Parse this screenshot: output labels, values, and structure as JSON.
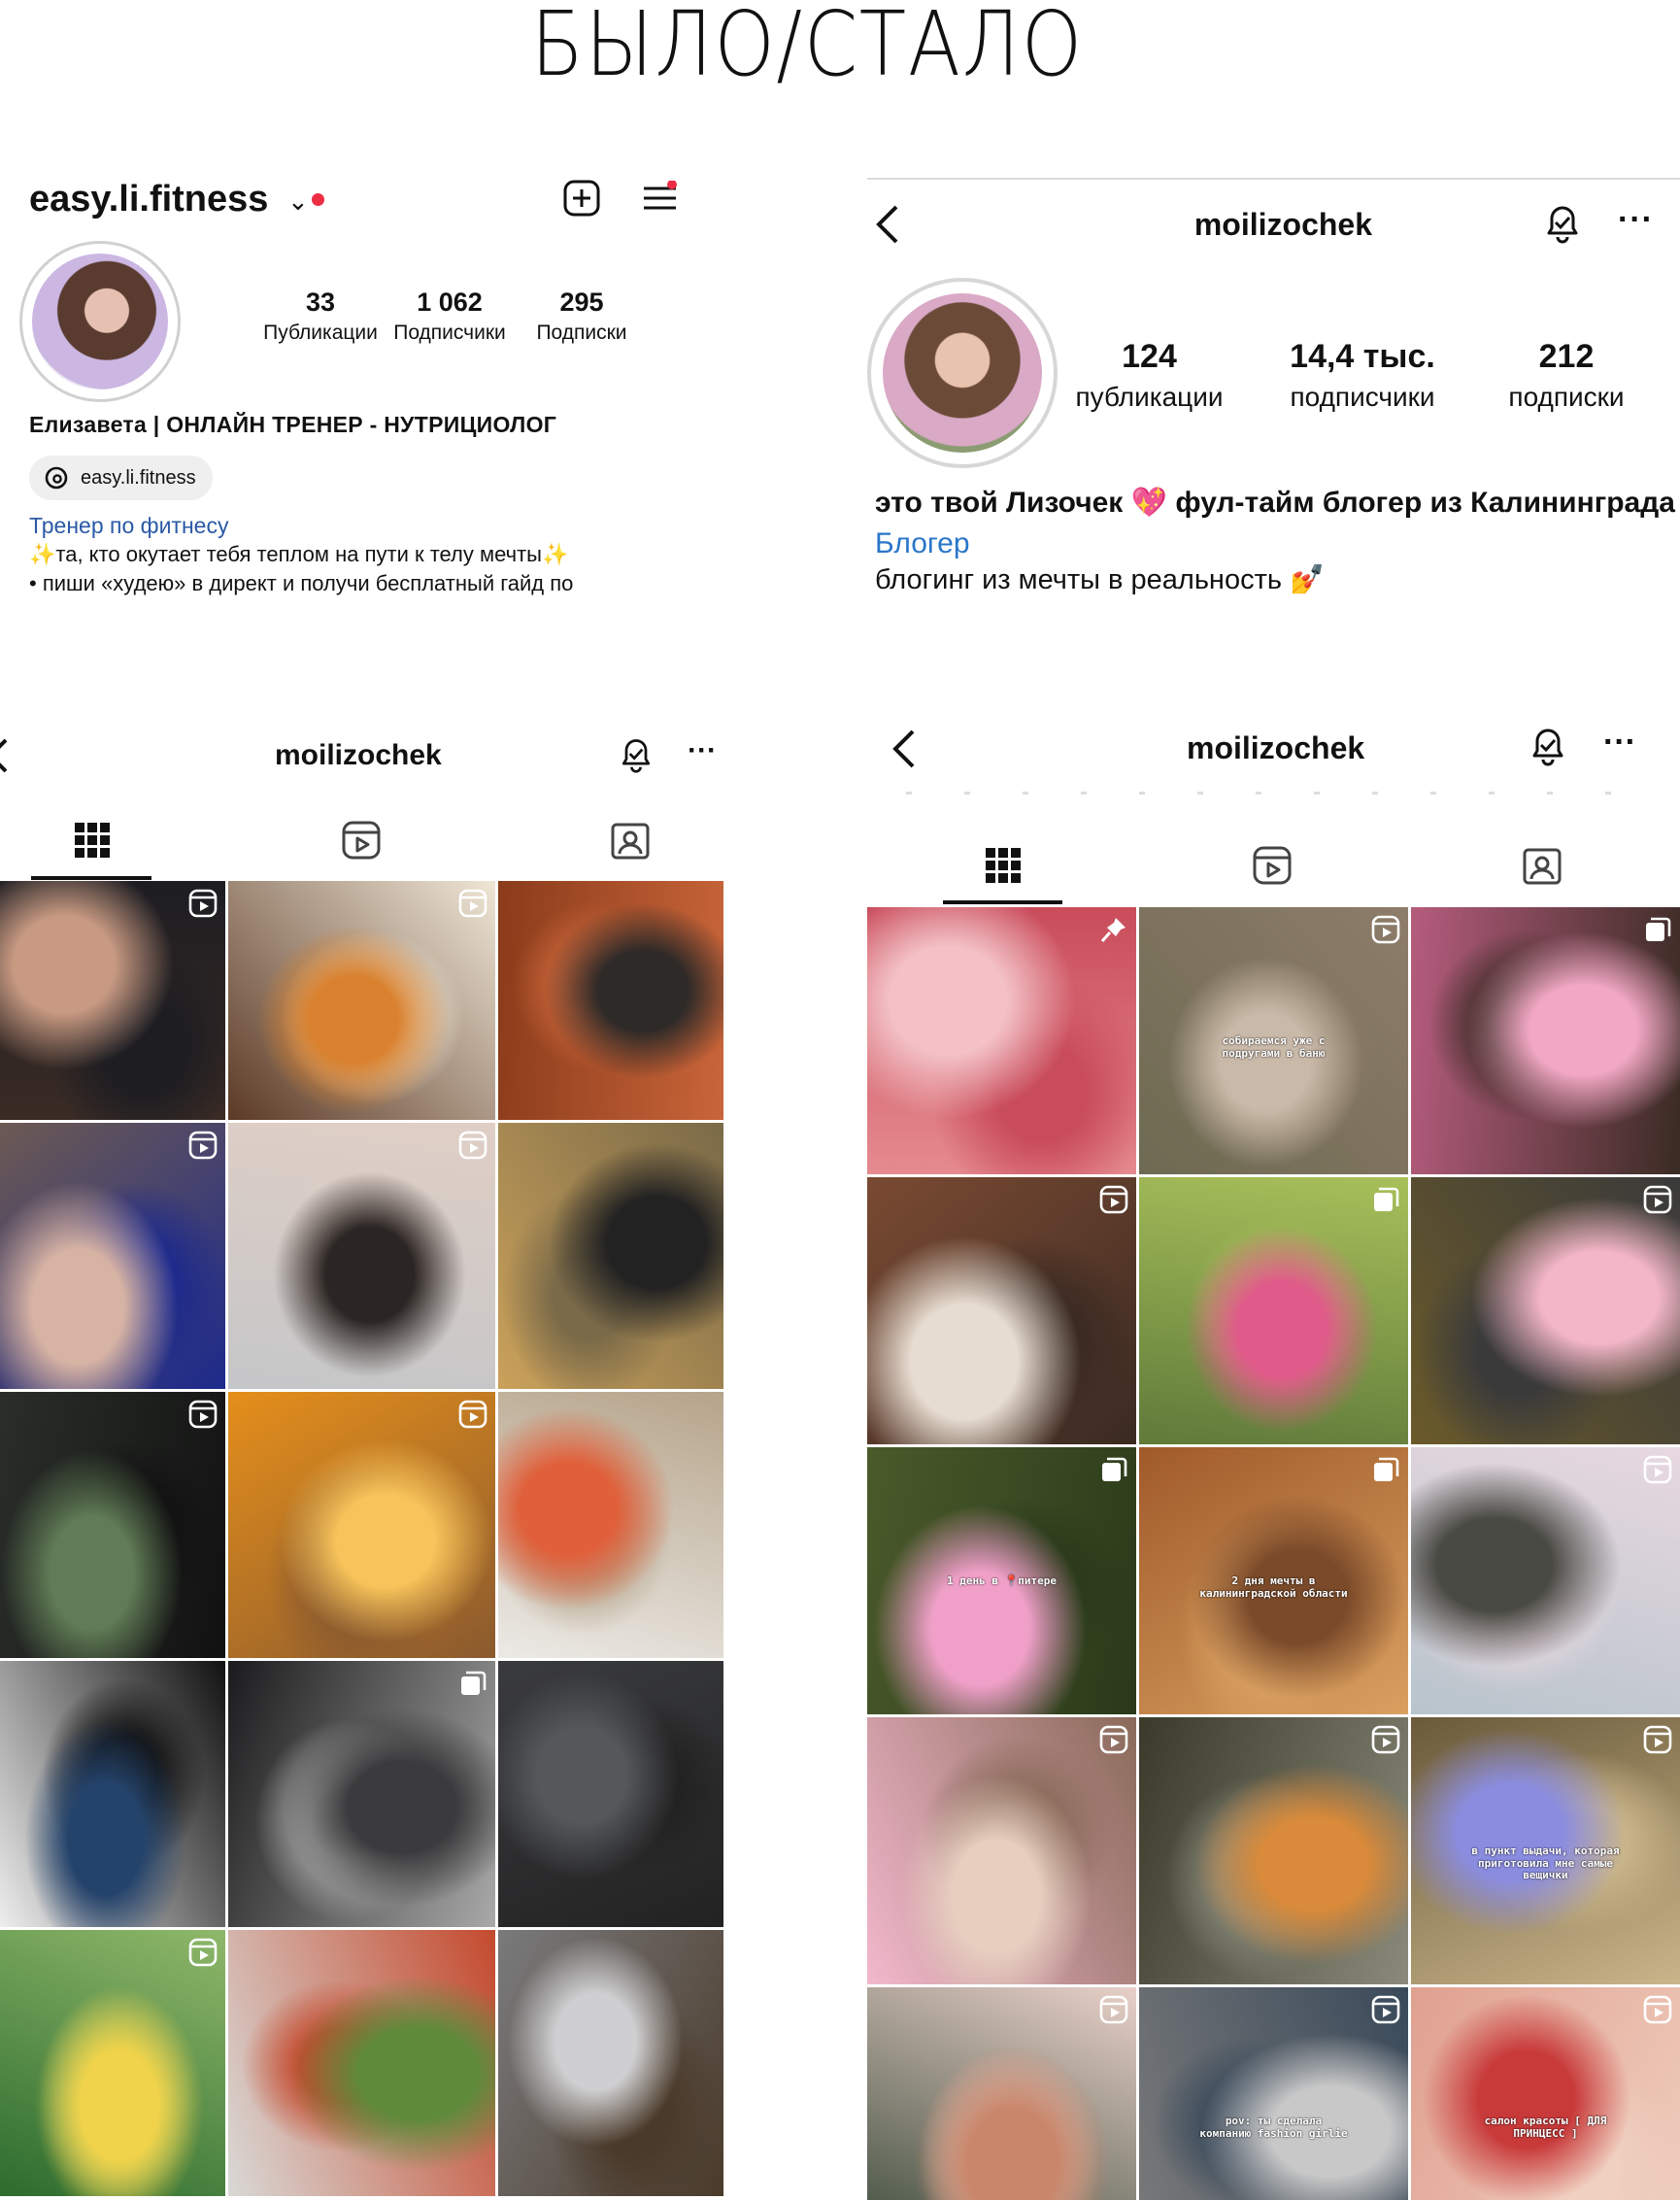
{
  "page_title": "БЫЛО/СТАЛО",
  "before_profile": {
    "username": "easy.li.fitness",
    "stats": [
      {
        "value": "33",
        "label": "Публикации"
      },
      {
        "value": "1 062",
        "label": "Подписчики"
      },
      {
        "value": "295",
        "label": "Подписки"
      }
    ],
    "name": "Елизавета | ОНЛАЙН ТРЕНЕР - НУТРИЦИОЛОГ",
    "threads_handle": "easy.li.fitness",
    "category": "Тренер по фитнесу",
    "bio_line_1": "✨та, кто окутает тебя теплом на пути к телу мечты✨",
    "bio_line_2": "• пиши «худею» в директ и получи бесплатный гайд по",
    "colors": {
      "notification_dot": "#ed2d44",
      "category_link": "#2b59a6"
    }
  },
  "after_profile": {
    "username": "moilizochek",
    "stats": [
      {
        "value": "124",
        "label": "публикации"
      },
      {
        "value": "14,4 тыс.",
        "label": "подписчики"
      },
      {
        "value": "212",
        "label": "подписки"
      }
    ],
    "bio_line_1": "это твой Лизочек 💖 фул-тайм блогер из Калининграда",
    "category": "Блогер",
    "bio_line_2": "блогинг из мечты в реальность 💅",
    "colors": {
      "category_link": "#2a76c9"
    }
  },
  "before_grid": {
    "username": "moilizochek",
    "tabs": [
      "grid-icon",
      "reels-icon",
      "tagged-icon"
    ],
    "posts": [
      {
        "badge": "reel",
        "colors": [
          "#3a2b24",
          "#c89a82",
          "#1d1d22"
        ]
      },
      {
        "badge": "reel",
        "colors": [
          "#5b3a26",
          "#d9812e",
          "#efe6d6"
        ]
      },
      {
        "badge": "none",
        "colors": [
          "#8a3b1a",
          "#2e2a28",
          "#c9653a"
        ]
      },
      {
        "badge": "reel",
        "colors": [
          "#6d5a52",
          "#d7b3a4",
          "#1d2a8c"
        ]
      },
      {
        "badge": "reel",
        "colors": [
          "#c5c6c8",
          "#2b2523",
          "#e0cfc6"
        ]
      },
      {
        "badge": "none",
        "colors": [
          "#caa15a",
          "#222",
          "#7a6a48"
        ]
      },
      {
        "badge": "reel",
        "colors": [
          "#2a2f2a",
          "#607b55",
          "#111"
        ]
      },
      {
        "badge": "reel",
        "colors": [
          "#e58f1b",
          "#f7c35a",
          "#8a5a2e"
        ]
      },
      {
        "badge": "none",
        "colors": [
          "#eceae6",
          "#e0603b",
          "#b6a48a"
        ]
      },
      {
        "badge": "none",
        "colors": [
          "#f1f1f1",
          "#24436b",
          "#111"
        ]
      },
      {
        "badge": "carousel",
        "colors": [
          "#1b1a1c",
          "#3b3a3c",
          "#a9a9a9"
        ]
      },
      {
        "badge": "none",
        "colors": [
          "#3a3b3e",
          "#55575b",
          "#222"
        ]
      },
      {
        "badge": "reel",
        "colors": [
          "#2c6b2e",
          "#f0d34a",
          "#8fb86a"
        ]
      },
      {
        "badge": "none",
        "colors": [
          "#d9d9d6",
          "#5e8a3a",
          "#c44a2e"
        ]
      },
      {
        "badge": "none",
        "colors": [
          "#7a7a7c",
          "#cfcfd1",
          "#4a3a2a"
        ]
      }
    ]
  },
  "after_grid": {
    "username": "moilizochek",
    "tabs": [
      "grid-icon",
      "reels-icon",
      "tagged-icon"
    ],
    "posts": [
      {
        "badge": "pin",
        "caption": "",
        "colors": [
          "#e58b8f",
          "#f3c1c6",
          "#c94c5b"
        ]
      },
      {
        "badge": "reel",
        "caption": "собираемся уже с подругами в баню",
        "colors": [
          "#6e6a52",
          "#c9b9a8",
          "#8d7c6a"
        ]
      },
      {
        "badge": "carousel",
        "caption": "",
        "colors": [
          "#b55c7d",
          "#f2a8c4",
          "#3a2b24"
        ]
      },
      {
        "badge": "reel",
        "caption": "",
        "colors": [
          "#7a4a32",
          "#e7dcd0",
          "#3a2a22"
        ]
      },
      {
        "badge": "carousel",
        "caption": "",
        "colors": [
          "#5f7a3a",
          "#e05a8a",
          "#a8c05a"
        ]
      },
      {
        "badge": "reel",
        "caption": "",
        "colors": [
          "#6a5a2a",
          "#f3b6c8",
          "#3a3a3a"
        ]
      },
      {
        "badge": "carousel",
        "caption": "1 день в 📍питере",
        "colors": [
          "#4a5a2a",
          "#f0a0c8",
          "#2a3a1a"
        ]
      },
      {
        "badge": "carousel",
        "caption": "2 дня мечты в калининградской области",
        "colors": [
          "#a05a2a",
          "#7a4a2a",
          "#d9a060"
        ]
      },
      {
        "badge": "reel",
        "caption": "",
        "colors": [
          "#b8c4cc",
          "#4a4a44",
          "#e8d8e0"
        ]
      },
      {
        "badge": "reel",
        "caption": "",
        "colors": [
          "#f2b8cc",
          "#e7cfc0",
          "#8a6a5a"
        ]
      },
      {
        "badge": "reel",
        "caption": "",
        "colors": [
          "#3a3a2a",
          "#d98a3a",
          "#8a8a7a"
        ]
      },
      {
        "badge": "reel",
        "caption": "в пункт выдачи, которая приготовила мне самые вещички",
        "colors": [
          "#6a5a3a",
          "#8a8ce0",
          "#c9b58a"
        ]
      },
      {
        "badge": "reel",
        "caption": "",
        "colors": [
          "#3a4a3a",
          "#c9866a",
          "#e8d0c8"
        ]
      },
      {
        "badge": "reel",
        "caption": "pov: ты сделала компанию fashion girlie",
        "colors": [
          "#7a7a7a",
          "#c8c8c8",
          "#3a4a5a"
        ]
      },
      {
        "badge": "reel",
        "caption": "салон красоты [ ДЛЯ ПРИНЦЕСС ]",
        "colors": [
          "#e0a090",
          "#c83a3a",
          "#f0d0c0"
        ]
      }
    ]
  }
}
